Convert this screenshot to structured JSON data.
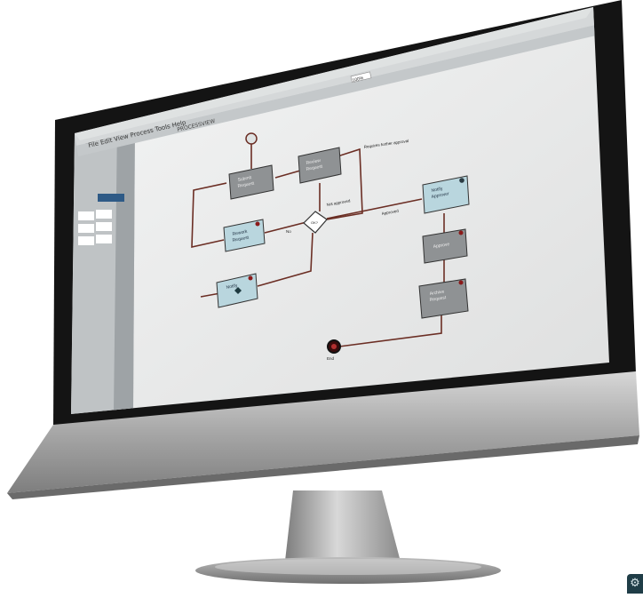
{
  "app": {
    "title_fragment": "PROCESSVIEW"
  },
  "toolbar": {
    "menu_items": [
      "File",
      "Edit",
      "View",
      "Process",
      "Tools",
      "Help"
    ],
    "zoom_value": "100%"
  },
  "diagram": {
    "nodes": [
      {
        "id": "start",
        "kind": "start-event"
      },
      {
        "id": "t1",
        "kind": "task",
        "style": "dark",
        "lines": [
          "Submit",
          "Request"
        ]
      },
      {
        "id": "t2",
        "kind": "task",
        "style": "dark",
        "lines": [
          "Review",
          "Request"
        ]
      },
      {
        "id": "gw",
        "kind": "gateway",
        "lines": [
          "OK?"
        ]
      },
      {
        "id": "t3",
        "kind": "task",
        "style": "light",
        "lines": [
          "Rework",
          "Request"
        ]
      },
      {
        "id": "t4",
        "kind": "task",
        "style": "light",
        "lines": [
          "Notify"
        ]
      },
      {
        "id": "t5",
        "kind": "task",
        "style": "light",
        "lines": [
          "Notify",
          "Approver"
        ]
      },
      {
        "id": "t6",
        "kind": "task",
        "style": "dark",
        "lines": [
          "Approve"
        ]
      },
      {
        "id": "t7",
        "kind": "task",
        "style": "dark",
        "lines": [
          "Archive",
          "Request"
        ]
      },
      {
        "id": "end",
        "kind": "end-event",
        "lines": [
          "End"
        ]
      }
    ],
    "edge_labels": [
      "Requires further approval",
      "Not approved",
      "Approved",
      "No"
    ]
  },
  "colors": {
    "canvas": "#eef0f0",
    "task_dark": "#8f9294",
    "task_light": "#b9d6de",
    "edge": "#6b2e24",
    "bezel": "#141414",
    "aluminum": "#b3b3b3"
  },
  "icons": [
    "settings-icon"
  ]
}
